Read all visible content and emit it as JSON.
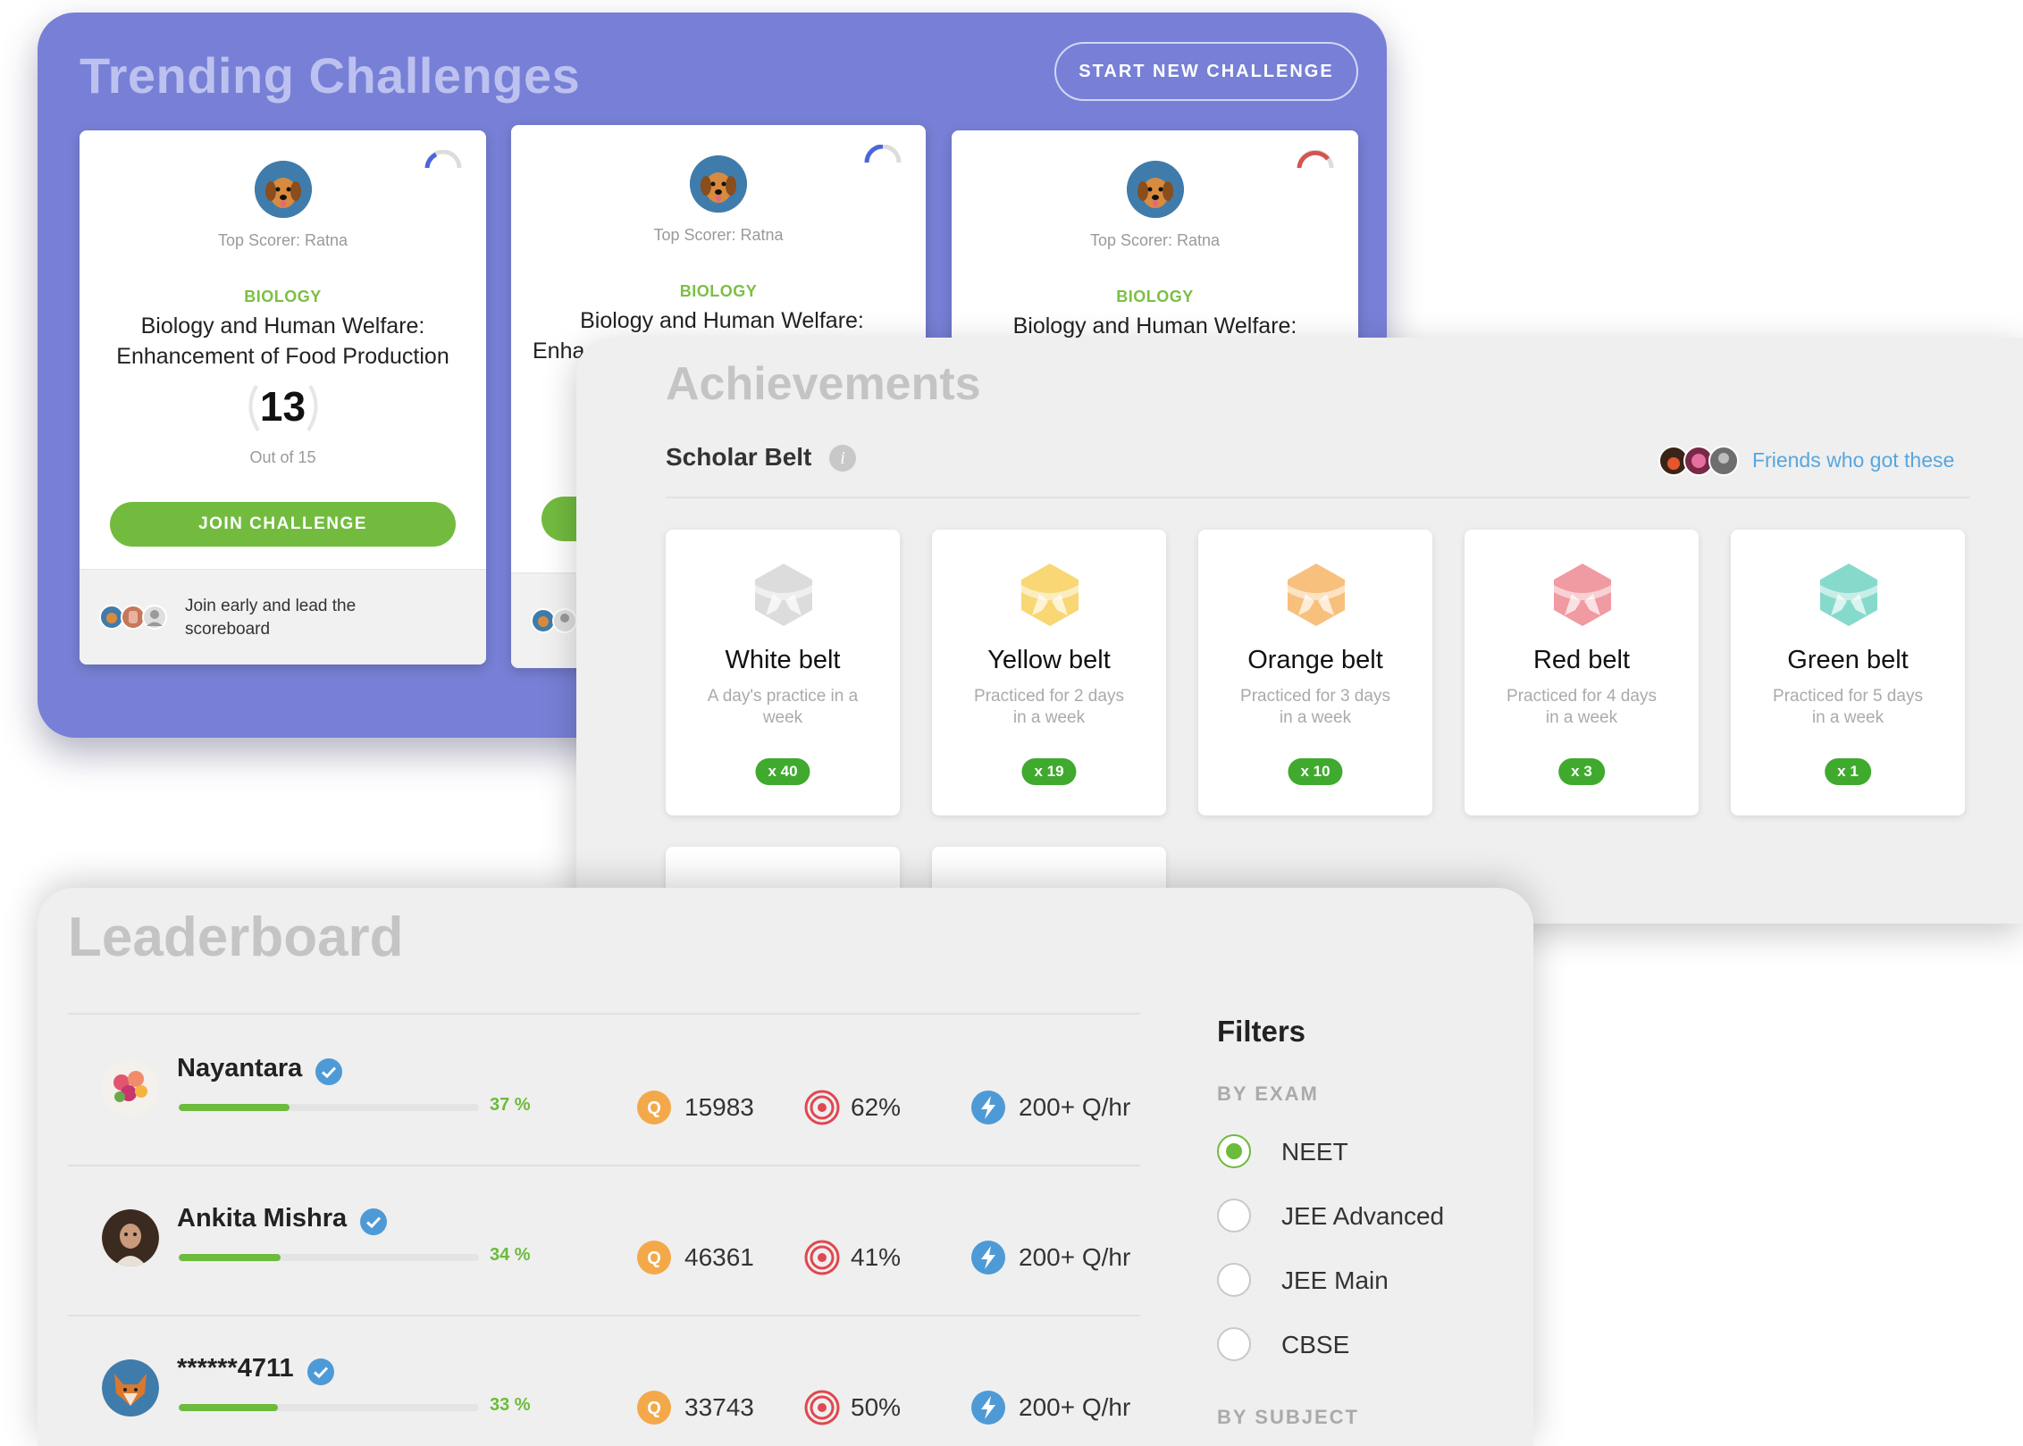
{
  "trending": {
    "title": "Trending Challenges",
    "start_button": "START NEW CHALLENGE",
    "cards": [
      {
        "scorer": "Top Scorer: Ratna",
        "subject": "BIOLOGY",
        "title_line1": "Biology and Human Welfare:",
        "title_line2": "Enhancement of Food Production",
        "score": "13",
        "out_of": "Out of 15",
        "join_label": "JOIN CHALLENGE",
        "footer_line1": "Join early and lead the",
        "footer_line2": "scoreboard"
      },
      {
        "scorer": "Top Scorer: Ratna",
        "subject": "BIOLOGY",
        "title_line1": "Biology and Human Welfare:",
        "title_line2": "Enha"
      },
      {
        "scorer": "Top Scorer: Ratna",
        "subject": "BIOLOGY",
        "title_line1": "Biology and Human Welfare:"
      }
    ]
  },
  "achievements": {
    "title": "Achievements",
    "belt_heading": "Scholar Belt",
    "friends_link": "Friends who got these",
    "belts": [
      {
        "name": "White belt",
        "desc_line1": "A day's practice in a",
        "desc_line2": "week",
        "count": "x 40",
        "color": "#dcdcdc",
        "icon": "white-belt-icon"
      },
      {
        "name": "Yellow belt",
        "desc_line1": "Practiced for 2 days",
        "desc_line2": "in a week",
        "count": "x 19",
        "color": "#f8d774",
        "icon": "yellow-belt-icon"
      },
      {
        "name": "Orange belt",
        "desc_line1": "Practiced for 3 days",
        "desc_line2": "in a week",
        "count": "x 10",
        "color": "#f7c07d",
        "icon": "orange-belt-icon"
      },
      {
        "name": "Red belt",
        "desc_line1": "Practiced for 4 days",
        "desc_line2": "in a week",
        "count": "x 3",
        "color": "#f09aa1",
        "icon": "red-belt-icon"
      },
      {
        "name": "Green belt",
        "desc_line1": "Practiced for 5 days",
        "desc_line2": "in a week",
        "count": "x 1",
        "color": "#86dacb",
        "icon": "green-belt-icon"
      }
    ]
  },
  "leaderboard": {
    "title": "Leaderboard",
    "rows": [
      {
        "name": "Nayantara",
        "progress": 0.37,
        "pct": "37 %",
        "questions": "15983",
        "accuracy": "62%",
        "speed": "200+ Q/hr"
      },
      {
        "name": "Ankita Mishra",
        "progress": 0.34,
        "pct": "34 %",
        "questions": "46361",
        "accuracy": "41%",
        "speed": "200+ Q/hr"
      },
      {
        "name": "******4711",
        "progress": 0.33,
        "pct": "33 %",
        "questions": "33743",
        "accuracy": "50%",
        "speed": "200+ Q/hr"
      }
    ],
    "filters": {
      "title": "Filters",
      "by_exam": "BY EXAM",
      "exams": [
        "NEET",
        "JEE Advanced",
        "JEE Main",
        "CBSE"
      ],
      "selected_exam": "NEET",
      "by_subject": "BY SUBJECT"
    }
  },
  "colors": {
    "trending_bg": "#7780d6",
    "accent_green": "#6cbb3c",
    "link_blue": "#55a6e0"
  }
}
